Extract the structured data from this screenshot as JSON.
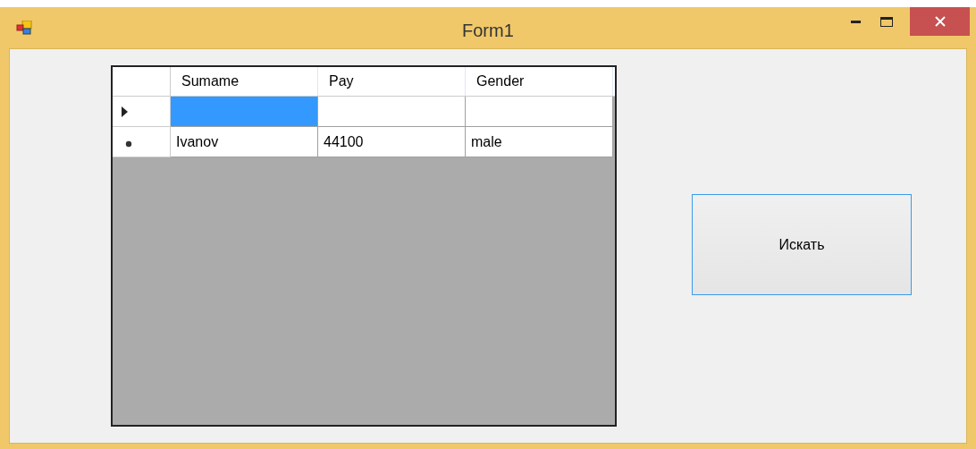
{
  "window": {
    "title": "Form1"
  },
  "table": {
    "columns": [
      "Sumame",
      "Pay",
      "Gender"
    ],
    "rows": [
      {
        "current": true,
        "new_row": false,
        "cells": [
          {
            "text": "",
            "selected": true
          },
          {
            "text": "",
            "selected": false
          },
          {
            "text": "",
            "selected": false
          }
        ]
      },
      {
        "current": false,
        "new_row": true,
        "cells": [
          {
            "text": "Ivanov",
            "selected": false
          },
          {
            "text": "44100",
            "selected": false
          },
          {
            "text": "male",
            "selected": false
          }
        ]
      }
    ]
  },
  "search_button": {
    "label": "Искать",
    "focused": true
  }
}
